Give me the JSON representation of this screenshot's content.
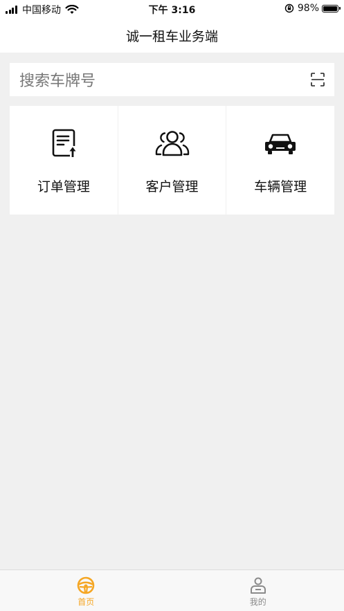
{
  "status_bar": {
    "carrier": "中国移动",
    "time": "下午 3:16",
    "battery_percent": "98%",
    "battery_level": 0.98,
    "icons": [
      "signal-icon",
      "wifi-icon",
      "orientation-lock-icon",
      "battery-icon"
    ]
  },
  "nav": {
    "title": "诚一租车业务端"
  },
  "search": {
    "placeholder": "搜索车牌号",
    "scan_icon": "scan-icon"
  },
  "menu": {
    "items": [
      {
        "label": "订单管理",
        "icon": "order-document-icon"
      },
      {
        "label": "客户管理",
        "icon": "customers-icon"
      },
      {
        "label": "车辆管理",
        "icon": "car-icon"
      }
    ]
  },
  "tab_bar": {
    "tabs": [
      {
        "label": "首页",
        "icon": "steering-wheel-icon",
        "active": true
      },
      {
        "label": "我的",
        "icon": "driver-profile-icon",
        "active": false
      }
    ],
    "active_color": "#f5a623",
    "inactive_color": "#8a8a8a"
  },
  "colors": {
    "background": "#f0f0f0",
    "card": "#ffffff",
    "accent": "#f5a623"
  }
}
